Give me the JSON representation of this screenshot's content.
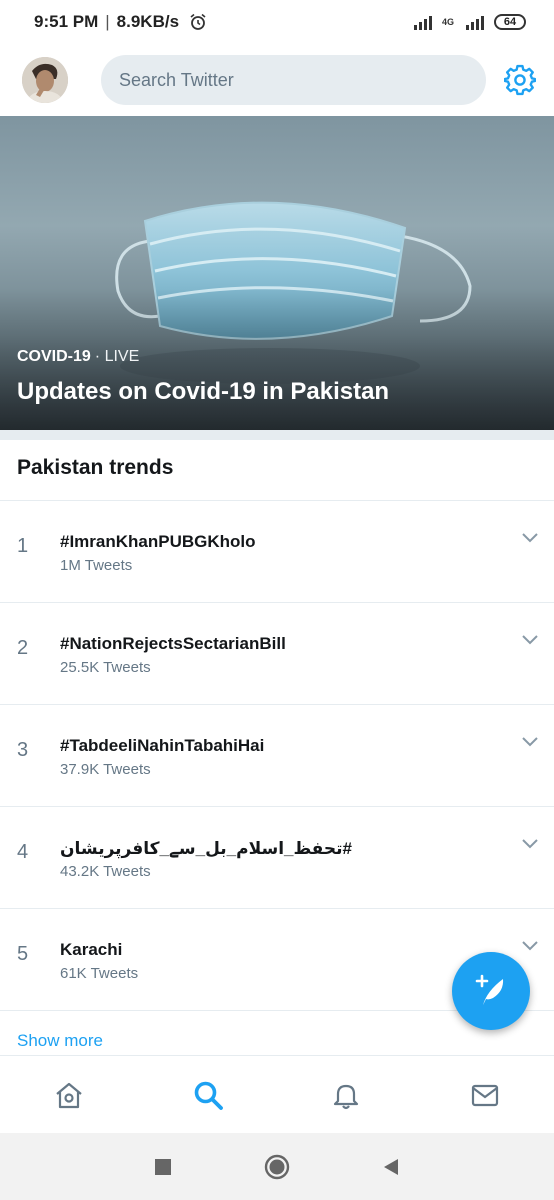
{
  "status_bar": {
    "time": "9:51 PM",
    "separator": "|",
    "net_speed": "8.9KB/s",
    "network_type": "4G",
    "battery": "64"
  },
  "header": {
    "search_placeholder": "Search Twitter",
    "avatar_icon": "profile-avatar",
    "settings_icon": "gear-icon"
  },
  "hero": {
    "category": "COVID-19",
    "live_label": "· LIVE",
    "title": "Updates on Covid-19 in Pakistan"
  },
  "trends": {
    "title": "Pakistan trends",
    "items": [
      {
        "rank": "1",
        "name": "#ImranKhanPUBGKholo",
        "count": "1M Tweets"
      },
      {
        "rank": "2",
        "name": "#NationRejectsSectarianBill",
        "count": "25.5K Tweets"
      },
      {
        "rank": "3",
        "name": "#TabdeeliNahinTabahiHai",
        "count": "37.9K Tweets"
      },
      {
        "rank": "4",
        "name": "#تحفظ_اسلام_بل_سے_کافرپریشان",
        "count": "43.2K Tweets"
      },
      {
        "rank": "5",
        "name": "Karachi",
        "count": "61K Tweets"
      }
    ],
    "show_more": "Show more"
  },
  "colors": {
    "accent": "#1da1f2",
    "muted": "#657786",
    "divider": "#e6ecf0"
  }
}
